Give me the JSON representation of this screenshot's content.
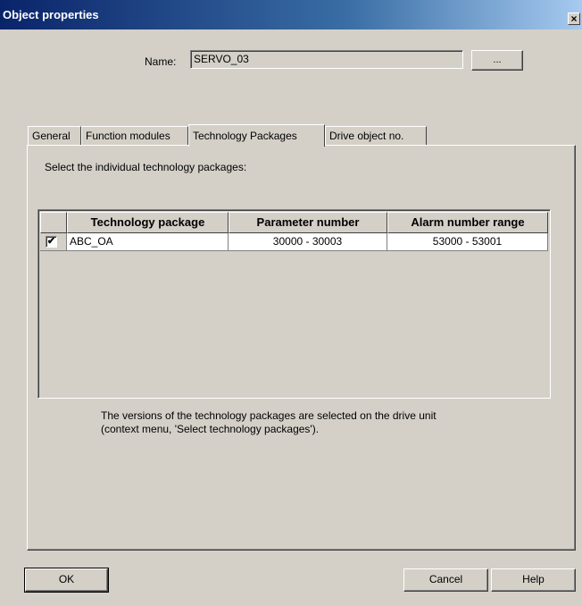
{
  "window": {
    "title": "Object properties",
    "close_glyph": "×"
  },
  "name": {
    "label": "Name:",
    "value": "SERVO_03",
    "browse_label": "..."
  },
  "tabs": [
    {
      "label": "General"
    },
    {
      "label": "Function modules"
    },
    {
      "label": "Technology Packages",
      "active": true
    },
    {
      "label": "Drive object no."
    }
  ],
  "panel": {
    "instruction": "Select the individual technology packages:",
    "table": {
      "columns": [
        "Technology package",
        "Parameter number",
        "Alarm number range"
      ],
      "rows": [
        {
          "checked": true,
          "checkmark": "✔",
          "package": "ABC_OA",
          "parameter": "30000 - 30003",
          "alarm": "53000 - 53001"
        }
      ]
    },
    "note_line1": "The versions of the technology packages are selected on the drive unit",
    "note_line2": "(context menu, 'Select technology packages')."
  },
  "buttons": {
    "ok": "OK",
    "cancel": "Cancel",
    "help": "Help"
  }
}
